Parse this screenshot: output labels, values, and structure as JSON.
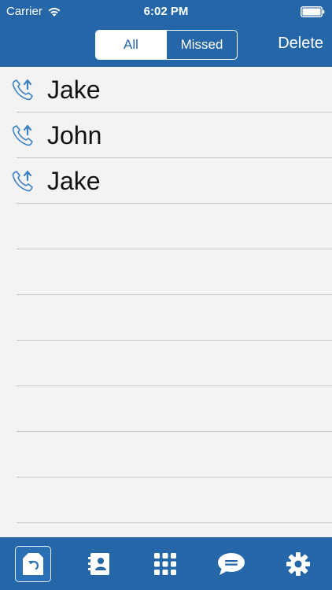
{
  "status_bar": {
    "carrier": "Carrier",
    "time": "6:02 PM"
  },
  "header": {
    "segments": [
      {
        "label": "All",
        "active": true
      },
      {
        "label": "Missed",
        "active": false
      }
    ],
    "delete_label": "Delete"
  },
  "calls": [
    {
      "name": "Jake",
      "type": "outgoing",
      "icon": "outgoing-call-icon"
    },
    {
      "name": "John",
      "type": "outgoing",
      "icon": "outgoing-call-icon"
    },
    {
      "name": "Jake",
      "type": "outgoing",
      "icon": "outgoing-call-icon"
    }
  ],
  "tabs": [
    {
      "name": "recents",
      "icon": "recents-icon",
      "selected": true
    },
    {
      "name": "contacts",
      "icon": "contacts-book-icon",
      "selected": false
    },
    {
      "name": "keypad",
      "icon": "keypad-icon",
      "selected": false
    },
    {
      "name": "messages",
      "icon": "chat-bubble-icon",
      "selected": false
    },
    {
      "name": "settings",
      "icon": "gear-icon",
      "selected": false
    }
  ],
  "colors": {
    "accent": "#2466a8",
    "background": "#f3f3f3",
    "icon_blue": "#3b82c4"
  }
}
